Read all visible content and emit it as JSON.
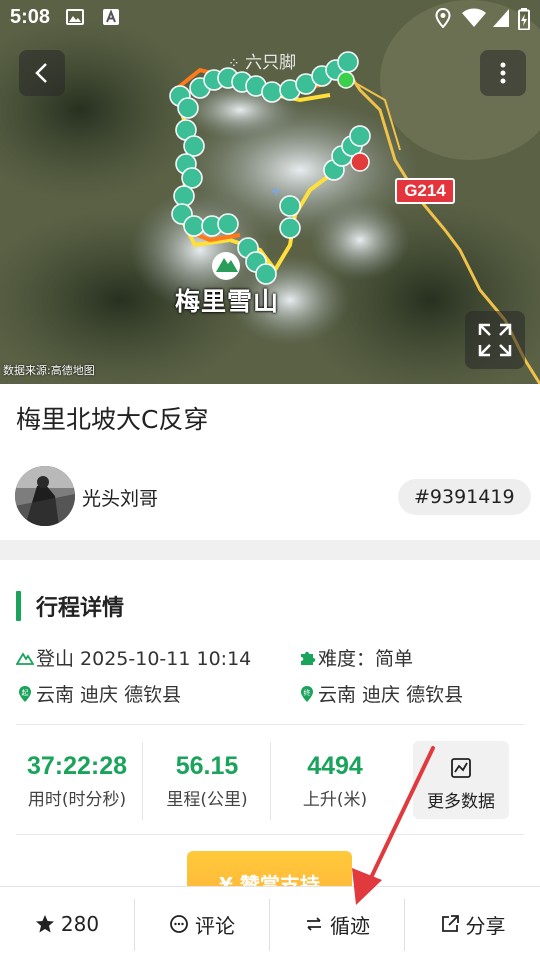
{
  "status_bar": {
    "time": "5:08"
  },
  "map": {
    "watermark": "六只脚",
    "source": "数据来源:高德地图",
    "place_label": "梅里雪山",
    "road_label": "G214"
  },
  "trip": {
    "title": "梅里北坡大C反穿",
    "author": "光头刘哥",
    "id": "#9391419"
  },
  "details": {
    "section_title": "行程详情",
    "start_time": "登山 2025-10-11 10:14",
    "difficulty": "难度：简单",
    "start_place": "云南 迪庆 德钦县",
    "end_place": "云南 迪庆 德钦县"
  },
  "stats": [
    {
      "value": "37:22:28",
      "label": "用时(时分秒)"
    },
    {
      "value": "56.15",
      "label": "里程(公里)"
    },
    {
      "value": "4494",
      "label": "上升(米)"
    }
  ],
  "more_data_label": "更多数据",
  "reward_label": "¥ 赞赏支持",
  "bottom_bar": {
    "favorites": "280",
    "comment": "评论",
    "follow_track": "循迹",
    "share": "分享"
  },
  "colors": {
    "accent": "#1aa35b",
    "road": "#e4343c",
    "reward": "#ffbe3a"
  }
}
